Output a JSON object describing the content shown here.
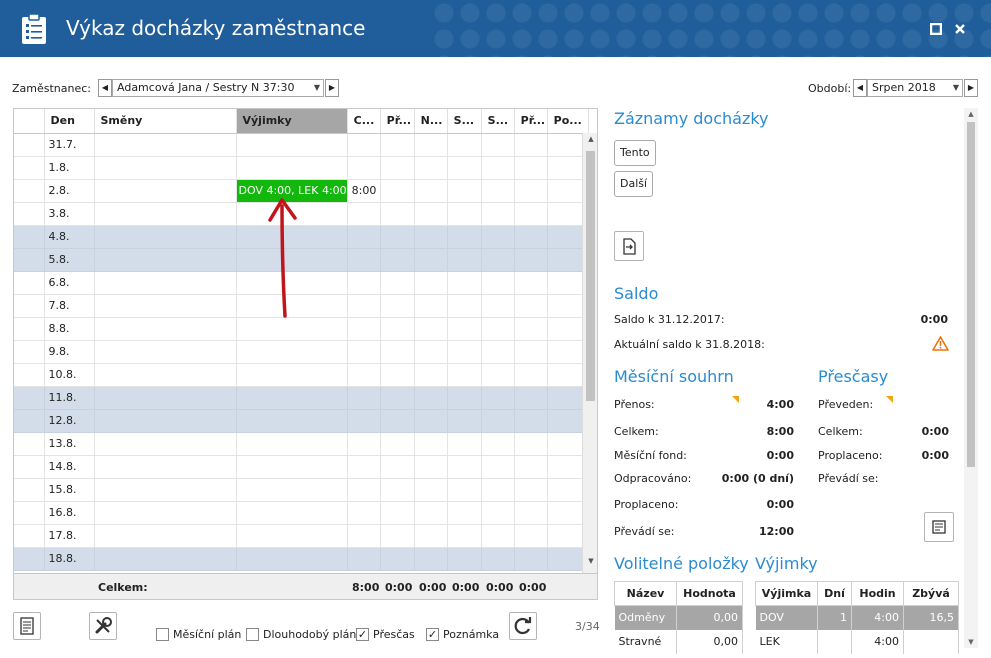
{
  "window": {
    "title": "Výkaz docházky zaměstnance"
  },
  "header": {
    "employee_label": "Zaměstnanec:",
    "employee_value": "Adamcová Jana / Sestry N 37:30",
    "period_label": "Období:",
    "period_value": "Srpen 2018"
  },
  "grid": {
    "columns": [
      "Den",
      "Směny",
      "Výjimky",
      "C...",
      "Př...",
      "N...",
      "S...",
      "S...",
      "Př...",
      "Po..."
    ],
    "rows": [
      {
        "day": "31.7.",
        "shift": "",
        "exception": "",
        "c": ""
      },
      {
        "day": "1.8.",
        "shift": "",
        "exception": "",
        "c": ""
      },
      {
        "day": "2.8.",
        "shift": "",
        "exception": "DOV 4:00, LEK 4:00",
        "c": "8:00"
      },
      {
        "day": "3.8.",
        "shift": "",
        "exception": "",
        "c": ""
      },
      {
        "day": "4.8.",
        "shift": "",
        "exception": "",
        "c": ""
      },
      {
        "day": "5.8.",
        "shift": "",
        "exception": "",
        "c": ""
      },
      {
        "day": "6.8.",
        "shift": "",
        "exception": "",
        "c": ""
      },
      {
        "day": "7.8.",
        "shift": "",
        "exception": "",
        "c": ""
      },
      {
        "day": "8.8.",
        "shift": "",
        "exception": "",
        "c": ""
      },
      {
        "day": "9.8.",
        "shift": "",
        "exception": "",
        "c": ""
      },
      {
        "day": "10.8.",
        "shift": "",
        "exception": "",
        "c": ""
      },
      {
        "day": "11.8.",
        "shift": "",
        "exception": "",
        "c": ""
      },
      {
        "day": "12.8.",
        "shift": "",
        "exception": "",
        "c": ""
      },
      {
        "day": "13.8.",
        "shift": "",
        "exception": "",
        "c": ""
      },
      {
        "day": "14.8.",
        "shift": "",
        "exception": "",
        "c": ""
      },
      {
        "day": "15.8.",
        "shift": "",
        "exception": "",
        "c": ""
      },
      {
        "day": "16.8.",
        "shift": "",
        "exception": "",
        "c": ""
      },
      {
        "day": "17.8.",
        "shift": "",
        "exception": "",
        "c": ""
      },
      {
        "day": "18.8.",
        "shift": "",
        "exception": "",
        "c": ""
      }
    ],
    "footer": {
      "label": "Celkem:",
      "totals": [
        "8:00",
        "0:00",
        "0:00",
        "0:00",
        "0:00",
        "0:00"
      ]
    }
  },
  "bottom": {
    "checkboxes": [
      {
        "label": "Měsíční plán",
        "checked": false
      },
      {
        "label": "Dlouhodobý plán",
        "checked": false
      },
      {
        "label": "Přesčas",
        "checked": true
      },
      {
        "label": "Poznámka",
        "checked": true
      }
    ],
    "page_counter": "3/34"
  },
  "records": {
    "title": "Záznamy docházky",
    "btn_current": "Tento",
    "btn_next": "Další"
  },
  "saldo": {
    "title": "Saldo",
    "saldo_label": "Saldo k 31.12.2017:",
    "saldo_value": "0:00",
    "current_label": "Aktuální saldo k 31.8.2018:"
  },
  "monthly": {
    "title": "Měsíční souhrn",
    "items": [
      {
        "label": "Přenos:",
        "value": "4:00"
      },
      {
        "label": "Celkem:",
        "value": "8:00"
      },
      {
        "label": "Měsíční fond:",
        "value": "0:00"
      },
      {
        "label": "Odpracováno:",
        "value": "0:00 (0 dní)"
      },
      {
        "label": "Proplaceno:",
        "value": "0:00"
      },
      {
        "label": "Převádí se:",
        "value": "12:00"
      }
    ]
  },
  "overtime": {
    "title": "Přesčasy",
    "items": [
      {
        "label": "Převeden:",
        "value": ""
      },
      {
        "label": "Celkem:",
        "value": "0:00"
      },
      {
        "label": "Proplaceno:",
        "value": "0:00"
      },
      {
        "label": "Převádí se:",
        "value": ""
      }
    ]
  },
  "optional": {
    "title": "Volitelné položky",
    "headers": [
      "Název",
      "Hodnota"
    ],
    "rows": [
      {
        "name": "Odměny",
        "value": "0,00"
      },
      {
        "name": "Stravné",
        "value": "0,00"
      }
    ]
  },
  "exceptions": {
    "title": "Výjimky",
    "headers": [
      "Výjimka",
      "Dní",
      "Hodin",
      "Zbývá"
    ],
    "rows": [
      {
        "name": "DOV",
        "days": "1",
        "hours": "4:00",
        "remaining": "16,5"
      },
      {
        "name": "LEK",
        "days": "",
        "hours": "4:00",
        "remaining": ""
      }
    ]
  },
  "colors": {
    "titlebar": "#1f5e9a",
    "accent": "#2a8bd0",
    "exception_green": "#12b80c",
    "weekend_row": "#d3dde9",
    "annotation_arrow": "#c0151b"
  }
}
